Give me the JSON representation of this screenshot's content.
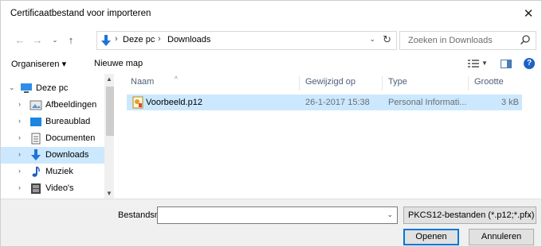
{
  "window": {
    "title": "Certificaatbestand voor importeren",
    "close_glyph": "✕"
  },
  "address": {
    "crumbs": [
      "Deze pc",
      "Downloads"
    ],
    "separator": "›",
    "refresh_glyph": "↻"
  },
  "search": {
    "placeholder": "Zoeken in Downloads"
  },
  "toolbar": {
    "organize_label": "Organiseren ▾",
    "new_folder_label": "Nieuwe map",
    "help_glyph": "?"
  },
  "nav": {
    "items": [
      {
        "label": "Deze pc",
        "icon": "pc-icon",
        "expanded": true
      },
      {
        "label": "Afbeeldingen",
        "icon": "pictures-icon"
      },
      {
        "label": "Bureaublad",
        "icon": "desktop-icon"
      },
      {
        "label": "Documenten",
        "icon": "documents-icon"
      },
      {
        "label": "Downloads",
        "icon": "downloads-icon",
        "selected": true
      },
      {
        "label": "Muziek",
        "icon": "music-icon"
      },
      {
        "label": "Video's",
        "icon": "videos-icon"
      }
    ]
  },
  "columns": {
    "name": "Naam",
    "modified": "Gewijzigd op",
    "type": "Type",
    "size": "Grootte"
  },
  "files": [
    {
      "name": "Voorbeeld.p12",
      "modified": "26-1-2017 15:38",
      "type": "Personal Informati...",
      "size": "3 kB",
      "icon": "certificate-file-icon"
    }
  ],
  "bottom": {
    "filename_label": "Bestandsnaam:",
    "filename_value": "",
    "filter_label": "PKCS12-bestanden (*.p12;*.pfx)",
    "open_label": "Openen",
    "cancel_label": "Annuleren"
  },
  "colors": {
    "accent": "#0078d7",
    "selection": "#cce8ff",
    "header_text": "#4c607a"
  }
}
